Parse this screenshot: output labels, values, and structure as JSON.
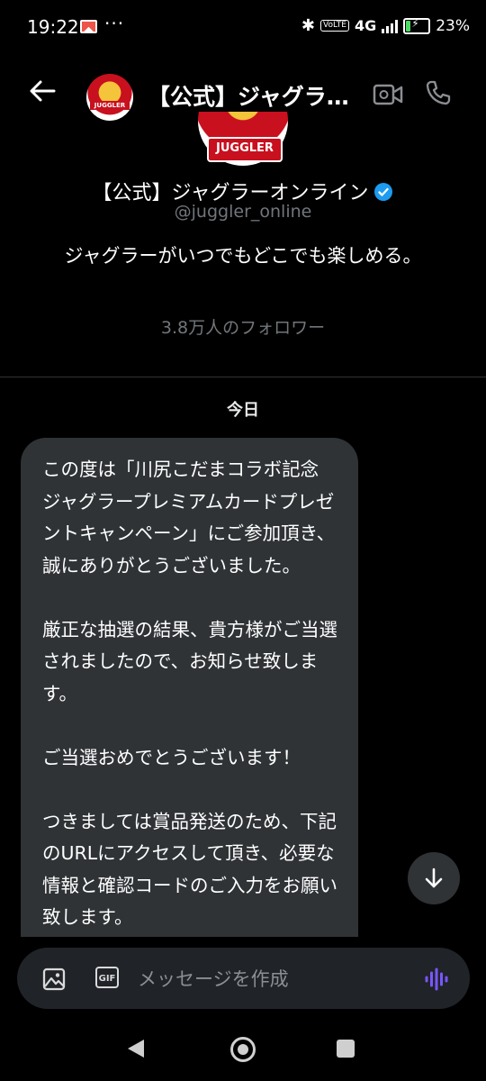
{
  "status_bar": {
    "time": "19:22",
    "more": "···",
    "network": "4G",
    "volte": "VoLTE",
    "battery": "23%",
    "battery_level": 0.23,
    "icons": [
      "gmail-icon",
      "bluetooth-icon",
      "signal-icon",
      "battery-charging-icon"
    ]
  },
  "header": {
    "title": "【公式】ジャグラーオンライン",
    "avatar_label": "JUGGLER",
    "icons": [
      "back-arrow-icon",
      "video-call-icon",
      "phone-call-icon"
    ]
  },
  "profile": {
    "name": "【公式】ジャグラーオンライン",
    "handle": "@juggler_online",
    "bio": "ジャグラーがいつでもどこでも楽しめる。",
    "followers": "3.8万人のフォロワー",
    "avatar_text": "JUGGLER"
  },
  "conversation": {
    "date_label": "今日",
    "message": "この度は「川尻こだまコラボ記念 ジャグラープレミアムカードプレゼントキャンペーン」にご参加頂き、誠にありがとうございました。\n\n厳正な抽選の結果、貴方様がご当選されましたので、お知らせ致します。\n\nご当選おめでとうございます！\n\nつきましては賞品発送のため、下記のURLにアクセスして頂き、必要な情報と確認コードのご入力をお願い致します。"
  },
  "composer": {
    "placeholder": "メッセージを作成",
    "gif_label": "GIF",
    "icons": [
      "image-icon",
      "gif-icon",
      "voice-message-icon"
    ]
  },
  "colors": {
    "background": "#000000",
    "bubble": "#2f3336",
    "secondary_text": "#71767b",
    "verified": "#1d9bf0",
    "accent_voice": "#7856ff"
  }
}
